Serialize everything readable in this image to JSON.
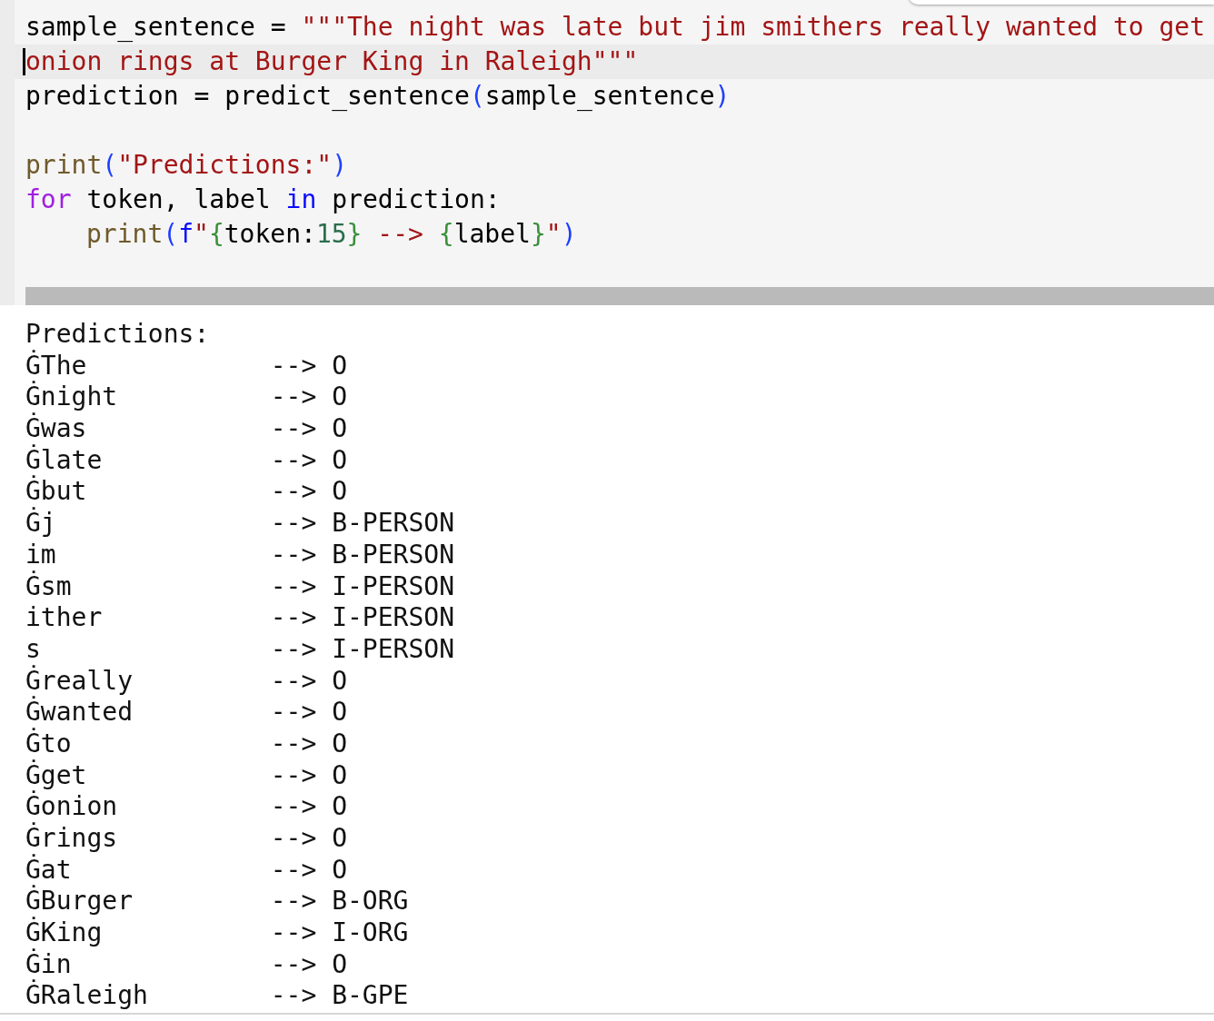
{
  "code": {
    "lines": [
      {
        "current": false,
        "tokens": [
          {
            "kind": "plain",
            "text": "sample_sentence = "
          },
          {
            "kind": "string",
            "text": "\"\"\"The night was late but jim smithers really wanted to get"
          }
        ]
      },
      {
        "current": true,
        "tokens": [
          {
            "kind": "string",
            "text": "onion rings at Burger King in Raleigh\"\"\""
          }
        ]
      },
      {
        "current": false,
        "tokens": [
          {
            "kind": "plain",
            "text": "prediction = predict_sentence"
          },
          {
            "kind": "paren",
            "text": "("
          },
          {
            "kind": "plain",
            "text": "sample_sentence"
          },
          {
            "kind": "paren",
            "text": ")"
          }
        ]
      },
      {
        "current": false
      },
      {
        "current": false,
        "tokens": [
          {
            "kind": "builtin",
            "text": "print"
          },
          {
            "kind": "paren",
            "text": "("
          },
          {
            "kind": "string",
            "text": "\"Predictions:\""
          },
          {
            "kind": "paren",
            "text": ")"
          }
        ]
      },
      {
        "current": false,
        "tokens": [
          {
            "kind": "keyword",
            "text": "for"
          },
          {
            "kind": "plain",
            "text": " token, label "
          },
          {
            "kind": "operator",
            "text": "in"
          },
          {
            "kind": "plain",
            "text": " prediction:"
          }
        ]
      },
      {
        "current": false,
        "indented": true,
        "tokens": [
          {
            "kind": "builtin",
            "text": "print"
          },
          {
            "kind": "paren",
            "text": "("
          },
          {
            "kind": "operator",
            "text": "f"
          },
          {
            "kind": "string",
            "text": "\""
          },
          {
            "kind": "brace",
            "text": "{"
          },
          {
            "kind": "plain",
            "text": "token:"
          },
          {
            "kind": "number",
            "text": "15"
          },
          {
            "kind": "brace",
            "text": "}"
          },
          {
            "kind": "string",
            "text": " --> "
          },
          {
            "kind": "brace",
            "text": "{"
          },
          {
            "kind": "plain",
            "text": "label"
          },
          {
            "kind": "brace",
            "text": "}"
          },
          {
            "kind": "string",
            "text": "\""
          },
          {
            "kind": "paren",
            "text": ")"
          }
        ]
      }
    ]
  },
  "output": {
    "lines": [
      "Predictions:",
      "ĠThe            --> O",
      "Ġnight          --> O",
      "Ġwas            --> O",
      "Ġlate           --> O",
      "Ġbut            --> O",
      "Ġj              --> B-PERSON",
      "im              --> B-PERSON",
      "Ġsm             --> I-PERSON",
      "ither           --> I-PERSON",
      "s               --> I-PERSON",
      "Ġreally         --> O",
      "Ġwanted         --> O",
      "Ġto             --> O",
      "Ġget            --> O",
      "Ġonion          --> O",
      "Ġrings          --> O",
      "Ġat             --> O",
      "ĠBurger         --> B-ORG",
      "ĠKing           --> I-ORG",
      "Ġin             --> O",
      "ĠRaleigh        --> B-GPE"
    ]
  }
}
